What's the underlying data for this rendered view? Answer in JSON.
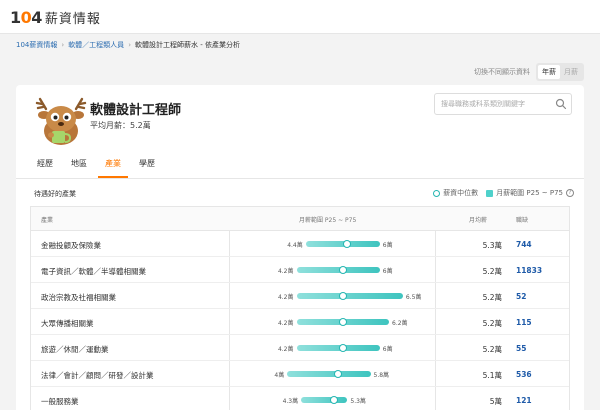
{
  "header": {
    "logo_number": "1",
    "logo_zero": "0",
    "logo_four": "4",
    "logo_text": "薪資情報"
  },
  "breadcrumb": [
    "104薪資情報",
    "軟體／工程類人員",
    "軟體設計工程師薪水 - 依產業分析"
  ],
  "period_toggle": {
    "hint": "切換不同顯示資料",
    "options": [
      "年薪",
      "月薪"
    ],
    "active": "年薪"
  },
  "job": {
    "title": "軟體設計工程師",
    "avg_salary": "平均月薪：5.2萬"
  },
  "search": {
    "placeholder": "搜尋職務或科系類別關鍵字"
  },
  "tabs": [
    "經歷",
    "地區",
    "產業",
    "學歷"
  ],
  "active_tab": "產業",
  "section": {
    "title": "待遇好的產業",
    "legend_median": "薪資中位數",
    "legend_range": "月薪範圍 P25 ~ P75",
    "info": "?"
  },
  "table": {
    "headers": {
      "industry": "產業",
      "range": "月薪範圍 P25 ~ P75",
      "median": "月均薪",
      "count": "職缺"
    },
    "rows": [
      {
        "industry": "金融投顧及保險業",
        "p25": 4.4,
        "p75": 6,
        "median_val": 5.3,
        "low": "4.4萬",
        "high": "6萬",
        "median": "5.3萬",
        "count": "744"
      },
      {
        "industry": "電子資訊／軟體／半導體相關業",
        "p25": 4.2,
        "p75": 6,
        "median_val": 5.2,
        "low": "4.2萬",
        "high": "6萬",
        "median": "5.2萬",
        "count": "11833"
      },
      {
        "industry": "政治宗教及社福相關業",
        "p25": 4.2,
        "p75": 6.5,
        "median_val": 5.2,
        "low": "4.2萬",
        "high": "6.5萬",
        "median": "5.2萬",
        "count": "52"
      },
      {
        "industry": "大眾傳播相關業",
        "p25": 4.2,
        "p75": 6.2,
        "median_val": 5.2,
        "low": "4.2萬",
        "high": "6.2萬",
        "median": "5.2萬",
        "count": "115"
      },
      {
        "industry": "旅遊／休閒／運動業",
        "p25": 4.2,
        "p75": 6,
        "median_val": 5.2,
        "low": "4.2萬",
        "high": "6萬",
        "median": "5.2萬",
        "count": "55"
      },
      {
        "industry": "法律／會計／顧問／研發／設計業",
        "p25": 4,
        "p75": 5.8,
        "median_val": 5.1,
        "low": "4萬",
        "high": "5.8萬",
        "median": "5.1萬",
        "count": "536"
      },
      {
        "industry": "一般服務業",
        "p25": 4.3,
        "p75": 5.3,
        "median_val": 5,
        "low": "4.3萬",
        "high": "5.3萬",
        "median": "5萬",
        "count": "121"
      }
    ]
  },
  "colors": {
    "brand_orange": "#ff7800",
    "teal": "#26b6b2",
    "link_blue": "#1e5aa8"
  }
}
